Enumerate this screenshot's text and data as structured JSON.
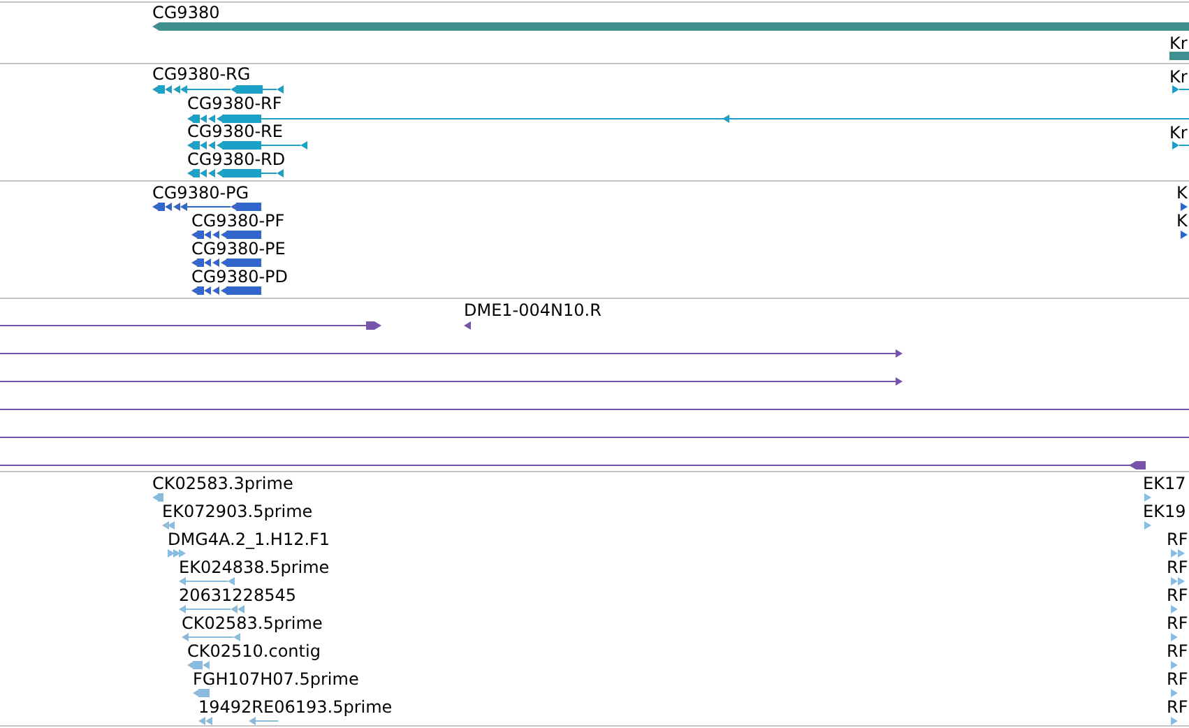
{
  "tracks": [
    {
      "kind": "gene",
      "color": "#3f8f8f",
      "features": [
        {
          "label": "CG9380"
        },
        {
          "label": "Kr"
        }
      ]
    },
    {
      "kind": "transcript",
      "color": "#1ba1c5",
      "features": [
        {
          "label": "CG9380-RG"
        },
        {
          "label": "CG9380-RF"
        },
        {
          "label": "CG9380-RE"
        },
        {
          "label": "CG9380-RD"
        },
        {
          "label": "Kr"
        },
        {
          "label": "Kr"
        }
      ]
    },
    {
      "kind": "protein",
      "color": "#3366cc",
      "features": [
        {
          "label": "CG9380-PG"
        },
        {
          "label": "CG9380-PF"
        },
        {
          "label": "CG9380-PE"
        },
        {
          "label": "CG9380-PD"
        },
        {
          "label": "K"
        },
        {
          "label": "K"
        }
      ]
    },
    {
      "kind": "alignment",
      "color": "#7755aa",
      "features": [
        {
          "label": "DME1-004N10.R"
        }
      ]
    },
    {
      "kind": "est",
      "color": "#88bbdd",
      "features": [
        {
          "label": "CK02583.3prime"
        },
        {
          "label": "EK072903.5prime"
        },
        {
          "label": "DMG4A.2_1.H12.F1"
        },
        {
          "label": "EK024838.5prime"
        },
        {
          "label": "20631228545"
        },
        {
          "label": "CK02583.5prime"
        },
        {
          "label": "CK02510.contig"
        },
        {
          "label": "FGH107H07.5prime"
        },
        {
          "label": "19492RE06193.5prime"
        },
        {
          "label": "EK17"
        },
        {
          "label": "EK19"
        },
        {
          "label": "RF"
        },
        {
          "label": "RF"
        },
        {
          "label": "RF"
        },
        {
          "label": "RF"
        },
        {
          "label": "RF"
        },
        {
          "label": "RF"
        },
        {
          "label": "RF"
        }
      ]
    }
  ]
}
